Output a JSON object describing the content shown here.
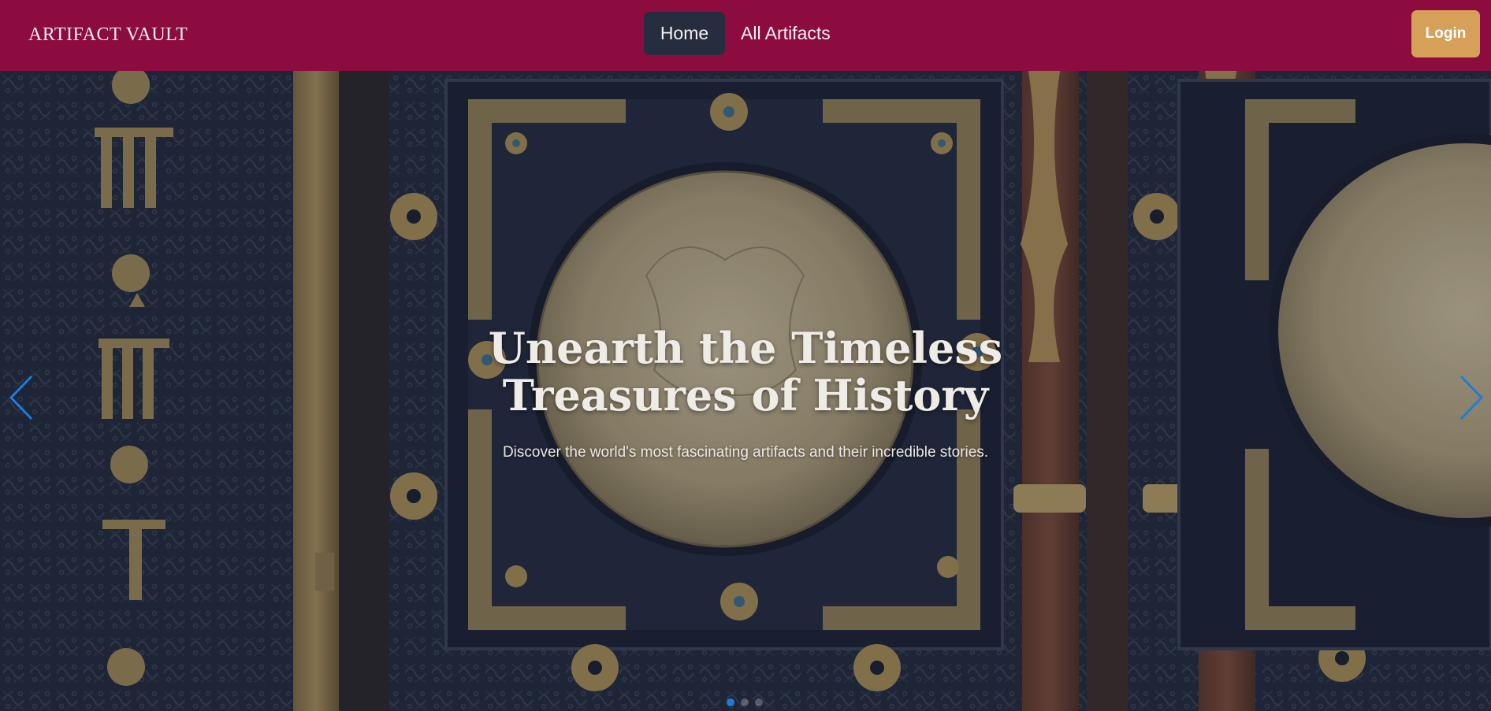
{
  "navbar": {
    "brand": "ARTIFACT VAULT",
    "links": [
      {
        "label": "Home",
        "active": true
      },
      {
        "label": "All Artifacts",
        "active": false
      }
    ],
    "login_label": "Login",
    "colors": {
      "background": "#8c0c40",
      "active_link_bg": "#262d3e",
      "login_bg": "#d6a059"
    }
  },
  "hero": {
    "title": "Unearth the Timeless Treasures of History",
    "subtitle": "Discover the world's most fascinating artifacts and their incredible stories.",
    "background_description": "ornate dark carved panel with bronze medallions and fretwork",
    "prev_icon": "chevron-left-icon",
    "next_icon": "chevron-right-icon",
    "accent_color": "#1f7bd8",
    "slides_total": 3,
    "active_slide": 1
  }
}
